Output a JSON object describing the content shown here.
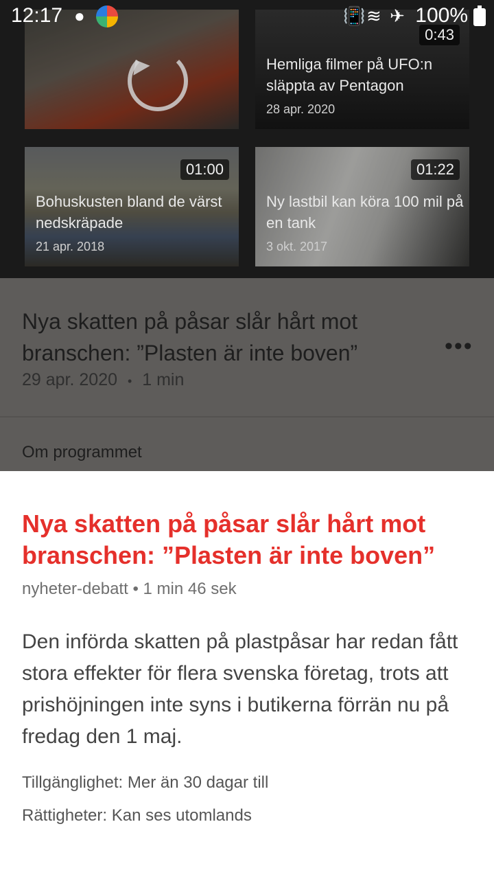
{
  "status_bar": {
    "time": "12:17",
    "battery": "100%",
    "icons": [
      "notification-icon",
      "app-icon",
      "vibrate-icon",
      "wifi-icon",
      "airplane-icon",
      "battery-icon"
    ]
  },
  "videos": [
    {
      "title": "",
      "date": "",
      "duration": "",
      "icon": "reload-icon"
    },
    {
      "title": "Hemliga filmer på UFO:n släppta av Pentagon",
      "date": "28 apr. 2020",
      "duration": "0:43"
    },
    {
      "title": "Bohuskusten bland de värst nedskräpade",
      "date": "21 apr. 2018",
      "duration": "01:00"
    },
    {
      "title": "Ny lastbil kan köra 100 mil på en tank",
      "date": "3 okt. 2017",
      "duration": "01:22"
    }
  ],
  "article": {
    "title": "Nya skatten på påsar slår hårt mot branschen: ”Plasten är inte boven”",
    "date": "29 apr. 2020",
    "separator": "•",
    "length": "1 min",
    "about_label": "Om programmet"
  },
  "sheet": {
    "title": "Nya skatten på påsar slår hårt mot branschen: ”Plasten är inte boven”",
    "meta": "nyheter-debatt • 1 min 46 sek",
    "description": "Den införda skatten på plastpåsar har redan fått stora effekter för flera svenska företag, trots att prishöjningen inte syns i butikerna förrän nu på fredag  den 1 maj.",
    "availability": "Tillgänglighet: Mer än 30 dagar till",
    "rights": "Rättigheter: Kan ses utomlands"
  }
}
